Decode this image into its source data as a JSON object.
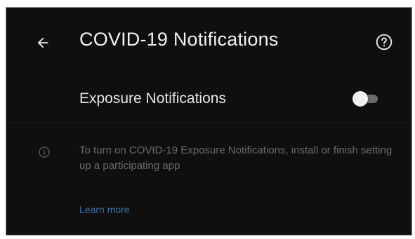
{
  "header": {
    "title": "COVID-19 Notifications",
    "back_icon": "arrow-left-icon",
    "help_icon": "help-circle-icon"
  },
  "exposure_row": {
    "label": "Exposure Notifications",
    "toggle_state": "off"
  },
  "info": {
    "icon": "info-circle-icon",
    "text": "To turn on COVID-19 Exposure Notifications, install or finish setting up a participating app",
    "link": "Learn more"
  },
  "colors": {
    "background": "#0f0f0f",
    "title_text": "#f2f2f2",
    "secondary_text": "#6a6a6a",
    "link": "#3b6ea8",
    "toggle_track": "#6b6b6b",
    "toggle_thumb": "#f1f1f1"
  }
}
